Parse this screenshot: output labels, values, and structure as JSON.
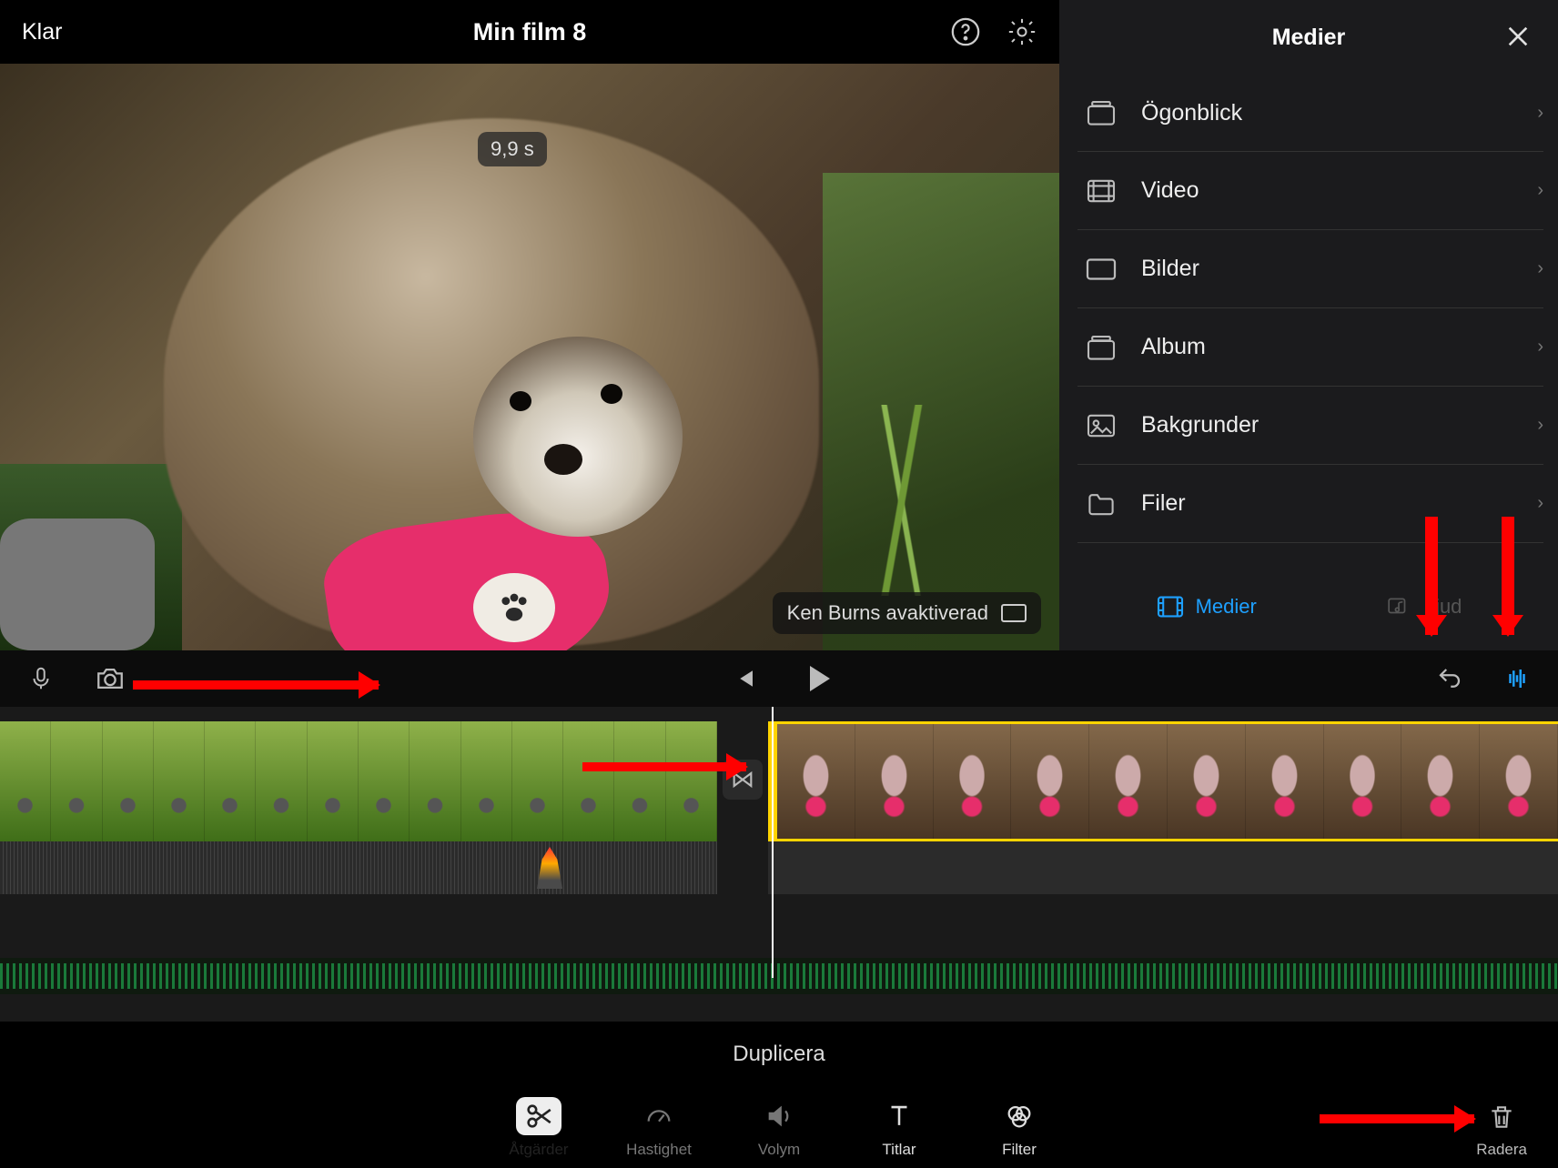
{
  "header": {
    "done": "Klar",
    "title": "Min film 8"
  },
  "preview": {
    "time_badge": "9,9 s",
    "kenburns_label": "Ken Burns avaktiverad"
  },
  "media": {
    "title": "Medier",
    "items": [
      {
        "label": "Ögonblick",
        "icon": "moments"
      },
      {
        "label": "Video",
        "icon": "video"
      },
      {
        "label": "Bilder",
        "icon": "photos"
      },
      {
        "label": "Album",
        "icon": "album"
      },
      {
        "label": "Bakgrunder",
        "icon": "backgrounds"
      },
      {
        "label": "Filer",
        "icon": "files"
      }
    ],
    "tabs": {
      "media": "Medier",
      "audio": "Ljud"
    }
  },
  "bottom": {
    "duplicate": "Duplicera",
    "tabs": {
      "actions": "Åtgärder",
      "speed": "Hastighet",
      "volume": "Volym",
      "titles": "Titlar",
      "filter": "Filter"
    },
    "delete": "Radera"
  },
  "colors": {
    "accent": "#1ea0ff",
    "selection": "#ffd400",
    "annotation": "#ff0000",
    "harness": "#e62e6b"
  }
}
